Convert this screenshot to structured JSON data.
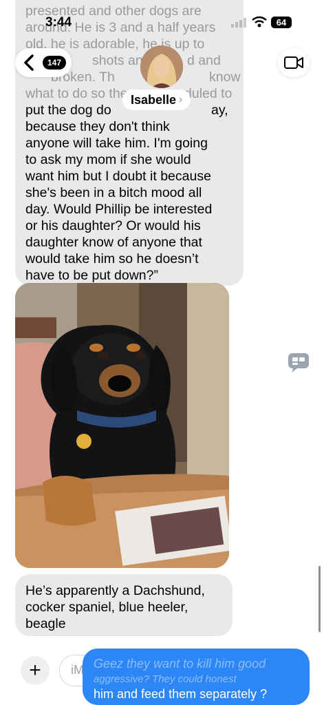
{
  "status_bar": {
    "time": "3:44",
    "battery": "64"
  },
  "header": {
    "back_count": "147",
    "contact_name": "Isabelle"
  },
  "messages": {
    "quoted_lines": [
      "presented and other dogs are",
      "around. He is 3 and a half years",
      "old, he is adorable, he is up to",
      "shots and",
      "d and",
      "broken. Th",
      "know",
      "what to do so they",
      "duled to",
      "put the dog do",
      "ay,",
      "because they don't think",
      "anyone will take him. I'm going",
      "to ask my mom if she would",
      "want him but I doubt it because",
      "she's been in a bitch mood all",
      "day. Would Phillip be interested",
      "or his daughter? Or would his",
      "daughter know of anyone that",
      "would take him so he doesn’t",
      "have to be put down?”"
    ],
    "breed_lines": [
      "He’s apparently a Dachshund,",
      "cocker spaniel, blue heeler,",
      "beagle"
    ]
  },
  "input": {
    "placeholder": "iMessage",
    "draft_lines": [
      "Geez they want to kill him good",
      "aggressive? They could honest",
      "him and feed them separately ?"
    ]
  },
  "colors": {
    "sent_blue": "#2c86f5",
    "received_gray": "#e9e9eb"
  },
  "icons": [
    "chevron-left-icon",
    "video-camera-icon",
    "plus-icon",
    "mic-icon",
    "wifi-icon",
    "signal-icon",
    "chat-bubbles-icon"
  ]
}
